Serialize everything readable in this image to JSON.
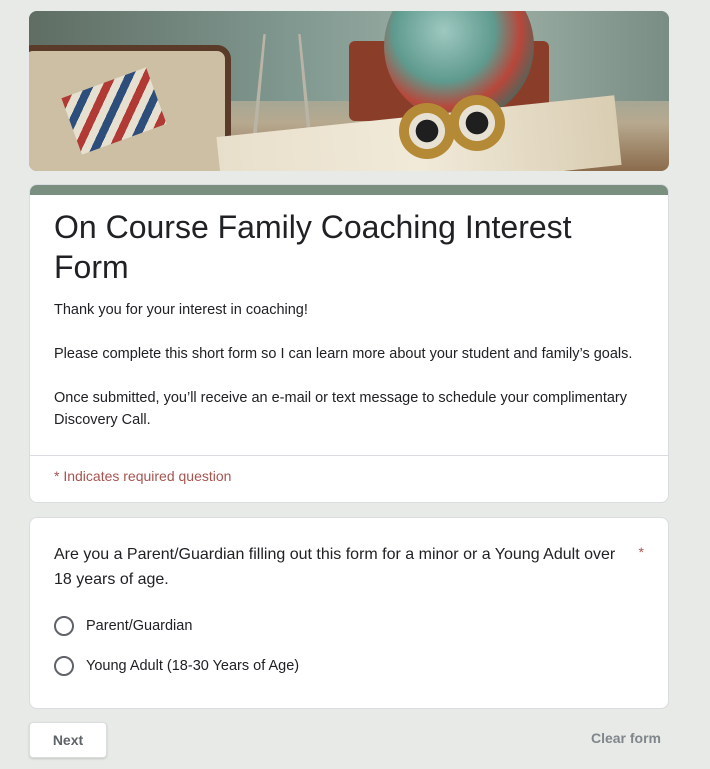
{
  "form": {
    "title": "On Course Family Coaching Interest Form",
    "description": [
      "Thank you for your interest in coaching!",
      "Please complete this short form so I can learn more about your student and family’s goals.",
      "Once submitted, you’ll receive an e-mail or text message to schedule your complimentary Discovery Call."
    ],
    "required_note": "* Indicates required question",
    "accent_color": "#7a8f80"
  },
  "question": {
    "text": "Are you a Parent/Guardian filling out this form for a minor or a Young Adult over 18 years of age.",
    "required_marker": "*",
    "options": [
      "Parent/Guardian",
      "Young Adult (18-30 Years of Age)"
    ]
  },
  "footer": {
    "next_label": "Next",
    "clear_label": "Clear form"
  }
}
